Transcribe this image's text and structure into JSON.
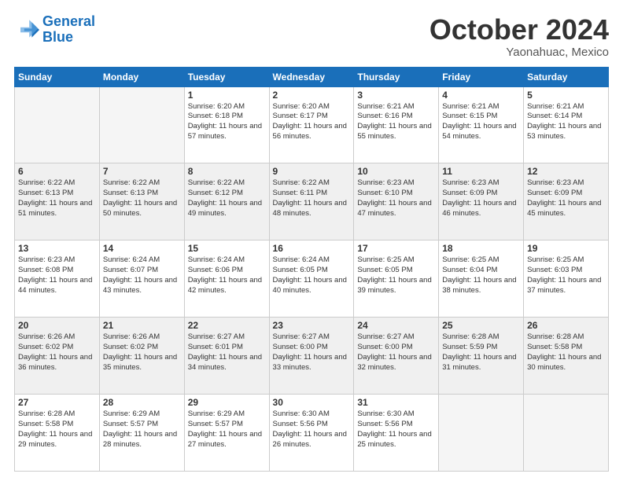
{
  "header": {
    "logo_line1": "General",
    "logo_line2": "Blue",
    "month": "October 2024",
    "location": "Yaonahuac, Mexico"
  },
  "days_of_week": [
    "Sunday",
    "Monday",
    "Tuesday",
    "Wednesday",
    "Thursday",
    "Friday",
    "Saturday"
  ],
  "weeks": [
    [
      {
        "day": "",
        "info": ""
      },
      {
        "day": "",
        "info": ""
      },
      {
        "day": "1",
        "info": "Sunrise: 6:20 AM\nSunset: 6:18 PM\nDaylight: 11 hours and 57 minutes."
      },
      {
        "day": "2",
        "info": "Sunrise: 6:20 AM\nSunset: 6:17 PM\nDaylight: 11 hours and 56 minutes."
      },
      {
        "day": "3",
        "info": "Sunrise: 6:21 AM\nSunset: 6:16 PM\nDaylight: 11 hours and 55 minutes."
      },
      {
        "day": "4",
        "info": "Sunrise: 6:21 AM\nSunset: 6:15 PM\nDaylight: 11 hours and 54 minutes."
      },
      {
        "day": "5",
        "info": "Sunrise: 6:21 AM\nSunset: 6:14 PM\nDaylight: 11 hours and 53 minutes."
      }
    ],
    [
      {
        "day": "6",
        "info": "Sunrise: 6:22 AM\nSunset: 6:13 PM\nDaylight: 11 hours and 51 minutes."
      },
      {
        "day": "7",
        "info": "Sunrise: 6:22 AM\nSunset: 6:13 PM\nDaylight: 11 hours and 50 minutes."
      },
      {
        "day": "8",
        "info": "Sunrise: 6:22 AM\nSunset: 6:12 PM\nDaylight: 11 hours and 49 minutes."
      },
      {
        "day": "9",
        "info": "Sunrise: 6:22 AM\nSunset: 6:11 PM\nDaylight: 11 hours and 48 minutes."
      },
      {
        "day": "10",
        "info": "Sunrise: 6:23 AM\nSunset: 6:10 PM\nDaylight: 11 hours and 47 minutes."
      },
      {
        "day": "11",
        "info": "Sunrise: 6:23 AM\nSunset: 6:09 PM\nDaylight: 11 hours and 46 minutes."
      },
      {
        "day": "12",
        "info": "Sunrise: 6:23 AM\nSunset: 6:09 PM\nDaylight: 11 hours and 45 minutes."
      }
    ],
    [
      {
        "day": "13",
        "info": "Sunrise: 6:23 AM\nSunset: 6:08 PM\nDaylight: 11 hours and 44 minutes."
      },
      {
        "day": "14",
        "info": "Sunrise: 6:24 AM\nSunset: 6:07 PM\nDaylight: 11 hours and 43 minutes."
      },
      {
        "day": "15",
        "info": "Sunrise: 6:24 AM\nSunset: 6:06 PM\nDaylight: 11 hours and 42 minutes."
      },
      {
        "day": "16",
        "info": "Sunrise: 6:24 AM\nSunset: 6:05 PM\nDaylight: 11 hours and 40 minutes."
      },
      {
        "day": "17",
        "info": "Sunrise: 6:25 AM\nSunset: 6:05 PM\nDaylight: 11 hours and 39 minutes."
      },
      {
        "day": "18",
        "info": "Sunrise: 6:25 AM\nSunset: 6:04 PM\nDaylight: 11 hours and 38 minutes."
      },
      {
        "day": "19",
        "info": "Sunrise: 6:25 AM\nSunset: 6:03 PM\nDaylight: 11 hours and 37 minutes."
      }
    ],
    [
      {
        "day": "20",
        "info": "Sunrise: 6:26 AM\nSunset: 6:02 PM\nDaylight: 11 hours and 36 minutes."
      },
      {
        "day": "21",
        "info": "Sunrise: 6:26 AM\nSunset: 6:02 PM\nDaylight: 11 hours and 35 minutes."
      },
      {
        "day": "22",
        "info": "Sunrise: 6:27 AM\nSunset: 6:01 PM\nDaylight: 11 hours and 34 minutes."
      },
      {
        "day": "23",
        "info": "Sunrise: 6:27 AM\nSunset: 6:00 PM\nDaylight: 11 hours and 33 minutes."
      },
      {
        "day": "24",
        "info": "Sunrise: 6:27 AM\nSunset: 6:00 PM\nDaylight: 11 hours and 32 minutes."
      },
      {
        "day": "25",
        "info": "Sunrise: 6:28 AM\nSunset: 5:59 PM\nDaylight: 11 hours and 31 minutes."
      },
      {
        "day": "26",
        "info": "Sunrise: 6:28 AM\nSunset: 5:58 PM\nDaylight: 11 hours and 30 minutes."
      }
    ],
    [
      {
        "day": "27",
        "info": "Sunrise: 6:28 AM\nSunset: 5:58 PM\nDaylight: 11 hours and 29 minutes."
      },
      {
        "day": "28",
        "info": "Sunrise: 6:29 AM\nSunset: 5:57 PM\nDaylight: 11 hours and 28 minutes."
      },
      {
        "day": "29",
        "info": "Sunrise: 6:29 AM\nSunset: 5:57 PM\nDaylight: 11 hours and 27 minutes."
      },
      {
        "day": "30",
        "info": "Sunrise: 6:30 AM\nSunset: 5:56 PM\nDaylight: 11 hours and 26 minutes."
      },
      {
        "day": "31",
        "info": "Sunrise: 6:30 AM\nSunset: 5:56 PM\nDaylight: 11 hours and 25 minutes."
      },
      {
        "day": "",
        "info": ""
      },
      {
        "day": "",
        "info": ""
      }
    ]
  ]
}
